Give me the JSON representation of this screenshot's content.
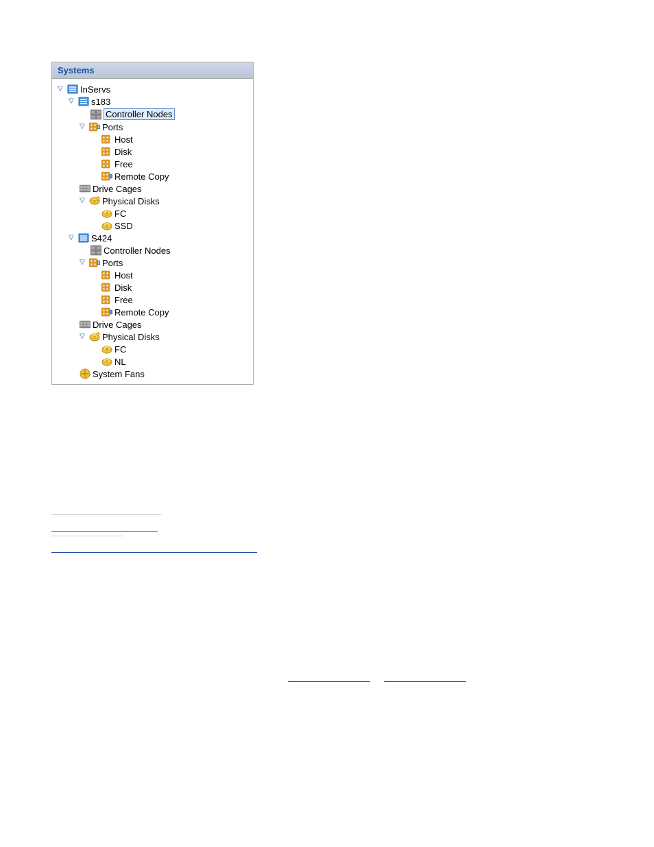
{
  "panel": {
    "title": "Systems"
  },
  "tree": {
    "items": [
      {
        "id": "inserv",
        "label": "InServs",
        "level": 1,
        "icon": "server",
        "expanded": true,
        "arrow": "down"
      },
      {
        "id": "s183",
        "label": "s183",
        "level": 2,
        "icon": "server",
        "expanded": true,
        "arrow": "down"
      },
      {
        "id": "s183-controller",
        "label": "Controller Nodes",
        "level": 3,
        "icon": "controller",
        "highlighted": true
      },
      {
        "id": "s183-ports",
        "label": "Ports",
        "level": 3,
        "icon": "ports",
        "expanded": true,
        "arrow": "down"
      },
      {
        "id": "s183-ports-host",
        "label": "Host",
        "level": 4,
        "icon": "ports-sub"
      },
      {
        "id": "s183-ports-disk",
        "label": "Disk",
        "level": 4,
        "icon": "ports-sub"
      },
      {
        "id": "s183-ports-free",
        "label": "Free",
        "level": 4,
        "icon": "ports-sub"
      },
      {
        "id": "s183-ports-rc",
        "label": "Remote Copy",
        "level": 4,
        "icon": "ports-rc"
      },
      {
        "id": "s183-drive-cages",
        "label": "Drive Cages",
        "level": 3,
        "icon": "drive-cages"
      },
      {
        "id": "s183-physical-disks",
        "label": "Physical Disks",
        "level": 3,
        "icon": "physical-disks",
        "expanded": true,
        "arrow": "down"
      },
      {
        "id": "s183-pd-fc",
        "label": "FC",
        "level": 4,
        "icon": "disk"
      },
      {
        "id": "s183-pd-ssd",
        "label": "SSD",
        "level": 4,
        "icon": "disk"
      },
      {
        "id": "s424",
        "label": "S424",
        "level": 2,
        "icon": "server",
        "expanded": true,
        "arrow": "down"
      },
      {
        "id": "s424-controller",
        "label": "Controller Nodes",
        "level": 3,
        "icon": "controller"
      },
      {
        "id": "s424-ports",
        "label": "Ports",
        "level": 3,
        "icon": "ports",
        "expanded": true,
        "arrow": "down"
      },
      {
        "id": "s424-ports-host",
        "label": "Host",
        "level": 4,
        "icon": "ports-sub"
      },
      {
        "id": "s424-ports-disk",
        "label": "Disk",
        "level": 4,
        "icon": "ports-sub"
      },
      {
        "id": "s424-ports-free",
        "label": "Free",
        "level": 4,
        "icon": "ports-sub"
      },
      {
        "id": "s424-ports-rc",
        "label": "Remote Copy",
        "level": 4,
        "icon": "ports-rc"
      },
      {
        "id": "s424-drive-cages",
        "label": "Drive Cages",
        "level": 3,
        "icon": "drive-cages"
      },
      {
        "id": "s424-physical-disks",
        "label": "Physical Disks",
        "level": 3,
        "icon": "physical-disks",
        "expanded": true,
        "arrow": "down"
      },
      {
        "id": "s424-pd-fc",
        "label": "FC",
        "level": 4,
        "icon": "disk"
      },
      {
        "id": "s424-pd-nl",
        "label": "NL",
        "level": 4,
        "icon": "disk"
      },
      {
        "id": "s424-system-fans",
        "label": "System Fans",
        "level": 3,
        "icon": "system-fans"
      }
    ]
  },
  "bottom_links": [
    {
      "label": "____________________",
      "type": "separator"
    },
    {
      "label": "____________",
      "type": "separator2"
    },
    {
      "label": "________________________________",
      "type": "link"
    },
    {
      "label": "________________",
      "type": "link2"
    },
    {
      "label": "________________",
      "type": "link3"
    }
  ]
}
